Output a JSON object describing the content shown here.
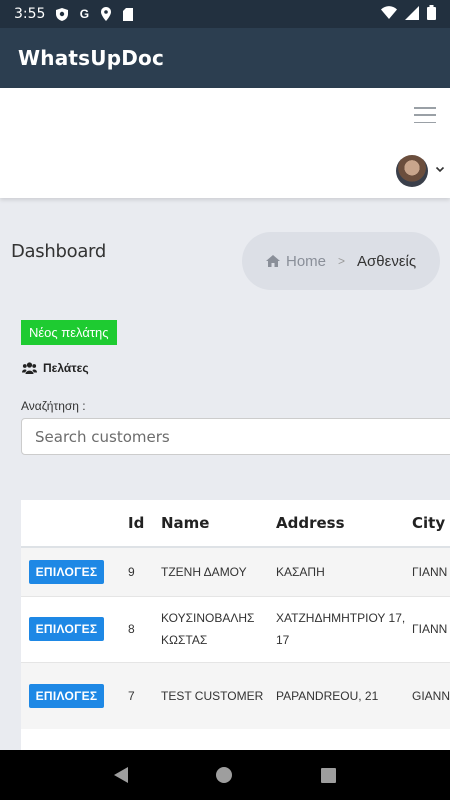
{
  "status_bar": {
    "time": "3:55",
    "icons": [
      "shield-icon",
      "google-icon",
      "location-icon",
      "sd-card-icon"
    ],
    "right_icons": [
      "wifi-icon",
      "signal-icon",
      "battery-icon"
    ]
  },
  "app": {
    "title": "WhatsUpDoc"
  },
  "header": {
    "menu_icon": "hamburger-icon",
    "avatar_caret": "chevron-down-icon"
  },
  "page": {
    "title": "Dashboard"
  },
  "breadcrumb": {
    "home": "Home",
    "separator": ">",
    "current": "Ασθενείς"
  },
  "new_customer_label": "Νέος πελάτης",
  "section_title": "Πελάτες",
  "search": {
    "label": "Αναζήτηση :",
    "placeholder": "Search customers",
    "value": ""
  },
  "table": {
    "columns": [
      "",
      "Id",
      "Name",
      "Address",
      "City"
    ],
    "rows": [
      {
        "button": "ΕΠΙΛΟΓΕΣ",
        "id": "9",
        "name": "ΤΖΕΝΗ ΔΑΜΟΥ",
        "address": "ΚΑΣΑΠΗ",
        "city": "ΓΙΑΝΝ"
      },
      {
        "button": "ΕΠΙΛΟΓΕΣ",
        "id": "8",
        "name": "ΚΟΥΣΙΝΟΒΑΛΗΣ ΚΩΣΤΑΣ",
        "address": "ΧΑΤΖΗΔΗΜΗΤΡΙΟΥ 17, 17",
        "city": "ΓΙΑΝΝ"
      },
      {
        "button": "ΕΠΙΛΟΓΕΣ",
        "id": "7",
        "name": "TEST CUSTOMER",
        "address": "PAPANDREOU, 21",
        "city": "GIANN"
      }
    ]
  },
  "colors": {
    "status_bar": "#22303f",
    "app_bar": "#2c3e50",
    "new_button": "#1ecb31",
    "option_button": "#1e88e5"
  }
}
